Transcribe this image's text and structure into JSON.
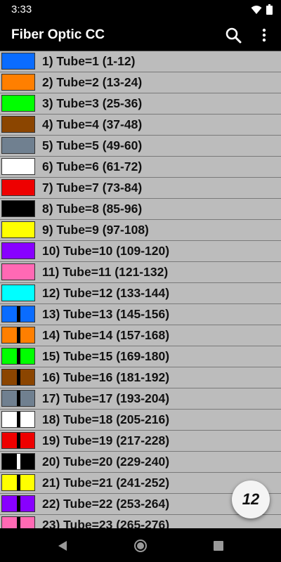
{
  "status_bar": {
    "time": "3:33",
    "icons": [
      "wifi-icon",
      "battery-icon"
    ]
  },
  "app_bar": {
    "title": "Fiber Optic CC",
    "actions": [
      "search-icon",
      "more-vert-icon"
    ]
  },
  "tubes": [
    {
      "label": "1) Tube=1 (1-12)",
      "color": "#0a6cff",
      "stripe": null
    },
    {
      "label": "2) Tube=2 (13-24)",
      "color": "#ff7f00",
      "stripe": null
    },
    {
      "label": "3) Tube=3 (25-36)",
      "color": "#00ff00",
      "stripe": null
    },
    {
      "label": "4) Tube=4 (37-48)",
      "color": "#8b4500",
      "stripe": null
    },
    {
      "label": "5) Tube=5 (49-60)",
      "color": "#708090",
      "stripe": null
    },
    {
      "label": "6) Tube=6 (61-72)",
      "color": "#ffffff",
      "stripe": null
    },
    {
      "label": "7) Tube=7 (73-84)",
      "color": "#ee0000",
      "stripe": null
    },
    {
      "label": "8) Tube=8 (85-96)",
      "color": "#000000",
      "stripe": null
    },
    {
      "label": "9) Tube=9 (97-108)",
      "color": "#ffff00",
      "stripe": null
    },
    {
      "label": "10) Tube=10 (109-120)",
      "color": "#8800ff",
      "stripe": null
    },
    {
      "label": "11) Tube=11 (121-132)",
      "color": "#ff69b4",
      "stripe": null
    },
    {
      "label": "12) Tube=12 (133-144)",
      "color": "#00ffff",
      "stripe": null
    },
    {
      "label": "13) Tube=13 (145-156)",
      "color": "#0a6cff",
      "stripe": "#000000"
    },
    {
      "label": "14) Tube=14 (157-168)",
      "color": "#ff7f00",
      "stripe": "#000000"
    },
    {
      "label": "15) Tube=15 (169-180)",
      "color": "#00ff00",
      "stripe": "#000000"
    },
    {
      "label": "16) Tube=16 (181-192)",
      "color": "#8b4500",
      "stripe": "#000000"
    },
    {
      "label": "17) Tube=17 (193-204)",
      "color": "#708090",
      "stripe": "#000000"
    },
    {
      "label": "18) Tube=18 (205-216)",
      "color": "#ffffff",
      "stripe": "#000000"
    },
    {
      "label": "19) Tube=19 (217-228)",
      "color": "#ee0000",
      "stripe": "#000000"
    },
    {
      "label": "20) Tube=20 (229-240)",
      "color": "#000000",
      "stripe": "#ffffff"
    },
    {
      "label": "21) Tube=21 (241-252)",
      "color": "#ffff00",
      "stripe": "#000000"
    },
    {
      "label": "22) Tube=22 (253-264)",
      "color": "#8800ff",
      "stripe": "#000000"
    },
    {
      "label": "23) Tube=23 (265-276)",
      "color": "#ff69b4",
      "stripe": "#000000"
    }
  ],
  "fab": {
    "label": "12"
  },
  "nav_bar": {
    "buttons": [
      "back-icon",
      "home-icon",
      "recents-icon"
    ]
  }
}
